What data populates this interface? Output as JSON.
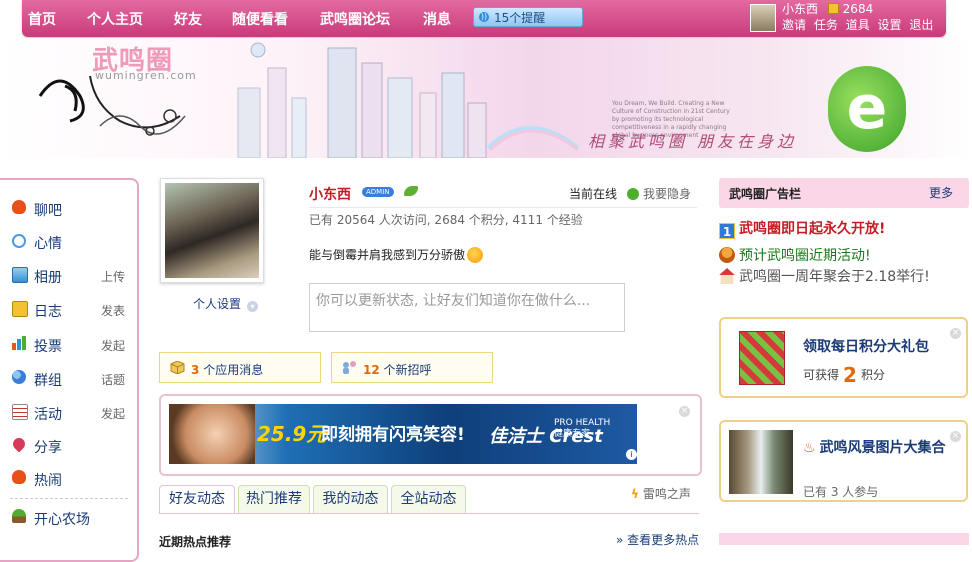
{
  "nav": {
    "items": [
      "首页",
      "个人主页",
      "好友",
      "随便看看",
      "武鸣圈论坛",
      "消息"
    ],
    "notice": "15个提醒",
    "user_name": "小东西",
    "score": "2684",
    "links": [
      "邀请",
      "任务",
      "道具",
      "设置",
      "退出"
    ]
  },
  "banner": {
    "logo": "武鸣圈",
    "domain": "wumingren.com",
    "slogan": "相聚武鸣圈 朋友在身边",
    "quote": "You Dream, We Build. Creating a New Culture of Construction in 21st Century by promoting its technological competitiveness in a rapidly changing global business environment"
  },
  "sidebar": {
    "items": [
      {
        "label": "聊吧",
        "action": "",
        "icon": "fire-icon",
        "color": "#e8501a"
      },
      {
        "label": "心情",
        "action": "",
        "icon": "speech-bubble-icon",
        "color": "#4a9be0"
      },
      {
        "label": "相册",
        "action": "上传",
        "icon": "photo-icon",
        "color": "#3a8fd0"
      },
      {
        "label": "日志",
        "action": "发表",
        "icon": "notebook-icon",
        "color": "#e0a020"
      },
      {
        "label": "投票",
        "action": "发起",
        "icon": "bar-chart-icon",
        "color": "#e05a20"
      },
      {
        "label": "群组",
        "action": "话题",
        "icon": "group-icon",
        "color": "#3a7ed8"
      },
      {
        "label": "活动",
        "action": "发起",
        "icon": "calendar-icon",
        "color": "#c0392b"
      },
      {
        "label": "分享",
        "action": "",
        "icon": "heart-share-icon",
        "color": "#d43a5a"
      },
      {
        "label": "热闹",
        "action": "",
        "icon": "fire-icon",
        "color": "#e8501a"
      },
      {
        "label": "开心农场",
        "action": "",
        "icon": "seedling-icon",
        "color": "#4fae2c"
      }
    ]
  },
  "profile": {
    "settings": "个人设置",
    "username": "小东西",
    "badge": "ADMIN",
    "online": "当前在线",
    "invisible": "我要隐身",
    "stats": "已有  20564 人次访问, 2684 个积分, 4111 个经验",
    "mood": "能与倒霉并肩我感到万分骄傲",
    "status_placeholder": "你可以更新状态, 让好友们知道你在做什么..."
  },
  "messages": {
    "apps_count": "3",
    "apps_label": "个应用消息",
    "greet_count": "12",
    "greet_label": "个新招呼"
  },
  "ad": {
    "price": "25.9元",
    "tagline": "即刻拥有闪亮笑容!",
    "brand": "佳洁士 Crest",
    "pro": "PRO HEALTH 健康专家",
    "info": "i"
  },
  "tabs": {
    "items": [
      "好友动态",
      "热门推荐",
      "我的动态",
      "全站动态"
    ],
    "thunder": "雷鸣之声",
    "heading_cut": "近期热点推荐",
    "more_cut": "» 查看更多热点"
  },
  "right": {
    "ads_title": "武鸣圈广告栏",
    "ads_more": "更多",
    "announcements": [
      "武鸣圈即日起永久开放!",
      "预计武鸣圈近期活动!",
      "武鸣圈一周年聚会于2.18举行!"
    ],
    "gift_title": "领取每日积分大礼包",
    "gift_prefix": "可获得",
    "gift_num": "2",
    "gift_suffix": "积分",
    "falls_title": "武鸣风景图片大集合",
    "falls_sub": "已有  3 人参与"
  },
  "colors": {
    "nav": "#c93a7a",
    "link": "#1a3b78",
    "username": "#c41c24",
    "accent_orange": "#e06a00"
  }
}
